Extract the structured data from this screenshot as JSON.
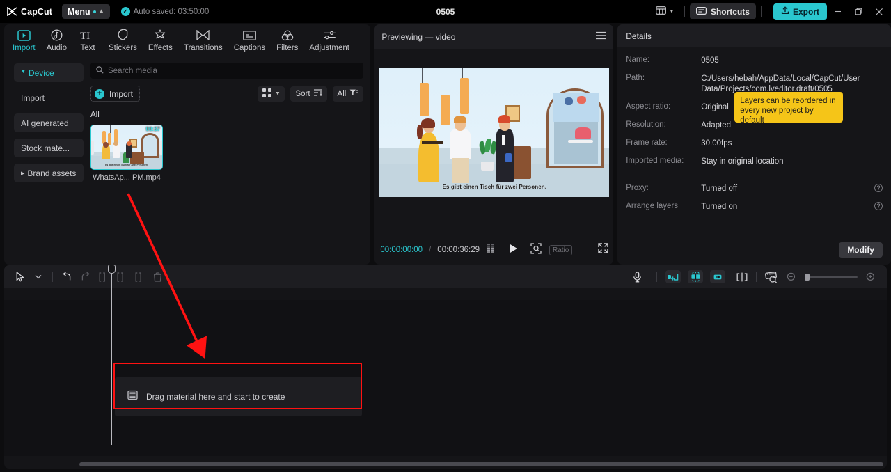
{
  "titlebar": {
    "brand": "CapCut",
    "menu_label": "Menu",
    "autosave_text": "Auto saved: 03:50:00",
    "project_title": "0505",
    "layout_icon": "layout-icon",
    "shortcuts_label": "Shortcuts",
    "shortcuts_icon": "keyboard-icon",
    "export_label": "Export",
    "export_icon": "upload-icon",
    "minimize_icon": "minimize-icon",
    "maximize_icon": "maximize-icon",
    "close_icon": "close-icon",
    "export_color": "#2ac7cf"
  },
  "nav_tabs": [
    {
      "label": "Import",
      "icon": "import-icon",
      "active": true
    },
    {
      "label": "Audio",
      "icon": "audio-icon",
      "active": false
    },
    {
      "label": "Text",
      "icon": "text-icon",
      "active": false
    },
    {
      "label": "Stickers",
      "icon": "stickers-icon",
      "active": false
    },
    {
      "label": "Effects",
      "icon": "effects-icon",
      "active": false
    },
    {
      "label": "Transitions",
      "icon": "transitions-icon",
      "active": false
    },
    {
      "label": "Captions",
      "icon": "captions-icon",
      "active": false
    },
    {
      "label": "Filters",
      "icon": "filters-icon",
      "active": false
    },
    {
      "label": "Adjustment",
      "icon": "adjustment-icon",
      "active": false
    }
  ],
  "side_list": [
    {
      "label": "Device",
      "active": true,
      "arrow": "down"
    },
    {
      "label": "Import",
      "active": false,
      "arrow": ""
    },
    {
      "label": "AI generated",
      "active": false,
      "arrow": ""
    },
    {
      "label": "Stock mate...",
      "active": false,
      "arrow": ""
    },
    {
      "label": "Brand assets",
      "active": false,
      "arrow": "right"
    }
  ],
  "media": {
    "search_placeholder": "Search media",
    "search_value": "",
    "search_icon": "search-icon",
    "import_label": "Import",
    "grid_icon": "grid-view-icon",
    "sort_label": "Sort",
    "sort_icon": "sort-icon",
    "filter_label": "All",
    "filter_icon": "filter-icon",
    "section_label": "All",
    "items": [
      {
        "name": "WhatsAp... PM.mp4",
        "duration": "00:37"
      }
    ]
  },
  "preview": {
    "header_title": "Previewing — video",
    "menu_icon": "hamburger-icon",
    "caption": "Es gibt einen Tisch für zwei Personen.",
    "current_time": "00:00:00:00",
    "time_separator": "/",
    "total_time": "00:00:36:29",
    "frames_icon": "frames-icon",
    "play_icon": "play-icon",
    "fit_icon": "fit-screen-icon",
    "ratio_label": "Ratio",
    "fullscreen_icon": "fullscreen-icon"
  },
  "details": {
    "header_title": "Details",
    "rows": [
      {
        "key": "Name:",
        "value": "0505"
      },
      {
        "key": "Path:",
        "value": "C:/Users/hebah/AppData/Local/CapCut/User Data/Projects/com.lveditor.draft/0505"
      },
      {
        "key": "Aspect ratio:",
        "value": "Original"
      },
      {
        "key": "Resolution:",
        "value": "Adapted"
      },
      {
        "key": "Frame rate:",
        "value": "30.00fps"
      },
      {
        "key": "Imported media:",
        "value": "Stay in original location"
      }
    ],
    "toggles": [
      {
        "key": "Proxy:",
        "value": "Turned off",
        "help": "?"
      },
      {
        "key": "Arrange layers",
        "value": "Turned on",
        "help": "?"
      }
    ],
    "tooltip_text": "Layers can be reordered in every new project by default",
    "tooltip_color": "#f5c518",
    "modify_label": "Modify"
  },
  "timeline": {
    "tools_left": [
      {
        "icon": "select-cursor-icon"
      },
      {
        "icon": "chevron-down-icon"
      },
      {
        "icon": "undo-icon"
      },
      {
        "icon": "redo-icon"
      },
      {
        "icon": "split-left-icon"
      },
      {
        "icon": "split-icon"
      },
      {
        "icon": "split-right-icon"
      },
      {
        "icon": "delete-icon"
      }
    ],
    "tools_right": [
      {
        "icon": "microphone-icon"
      },
      {
        "icon": "mirror-left-icon"
      },
      {
        "icon": "center-align-icon"
      },
      {
        "icon": "mirror-right-icon"
      },
      {
        "icon": "split-marker-icon"
      },
      {
        "icon": "ruler-icon"
      },
      {
        "icon": "zoom-out-icon"
      },
      {
        "icon": "zoom-in-icon"
      }
    ],
    "drop_label": "Drag material here and start to create",
    "drop_icon": "media-placeholder-icon",
    "highlight_color": "#ff1212",
    "arrow_color": "#ff1212"
  }
}
